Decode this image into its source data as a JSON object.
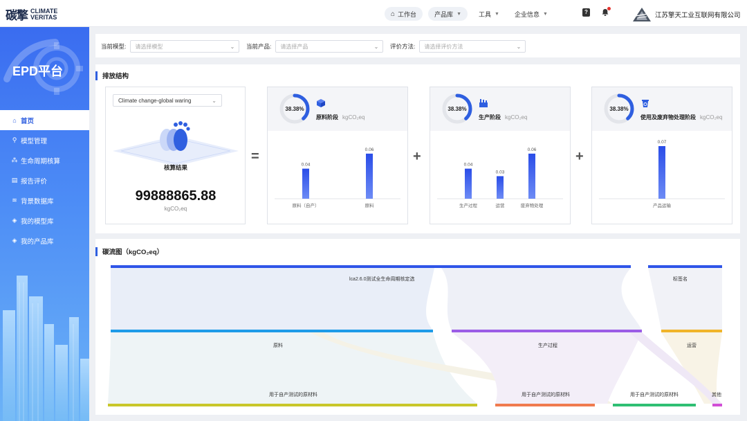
{
  "header": {
    "logo_cn": "碳擎",
    "logo_en_1": "CLIMATE",
    "logo_en_2": "VERITAS",
    "nav": [
      {
        "label": "工作台",
        "icon": "home-icon"
      },
      {
        "label": "产品库",
        "icon": "chevron-down-icon"
      },
      {
        "label": "工具",
        "icon": "chevron-down-icon"
      },
      {
        "label": "企业信息",
        "icon": "chevron-down-icon"
      }
    ],
    "help_glyph": "?",
    "company": "江苏擎天工业互联网有限公司"
  },
  "sidebar": {
    "title": "EPD平台",
    "items": [
      {
        "label": "首页",
        "icon": "home-icon"
      },
      {
        "label": "模型管理",
        "icon": "model-icon"
      },
      {
        "label": "生命周期核算",
        "icon": "lifecycle-icon"
      },
      {
        "label": "报告评价",
        "icon": "report-icon"
      },
      {
        "label": "背景数据库",
        "icon": "database-icon"
      },
      {
        "label": "我的模型库",
        "icon": "cube-icon"
      },
      {
        "label": "我的产品库",
        "icon": "cube-icon"
      }
    ]
  },
  "filters": [
    {
      "label": "当前模型:",
      "placeholder": "请选择模型"
    },
    {
      "label": "当前产品:",
      "placeholder": "请选择产品"
    },
    {
      "label": "评价方法:",
      "placeholder": "请选择评价方法"
    }
  ],
  "emission": {
    "title": "排放结构",
    "method": "Climate change-global waring",
    "result_label": "核算结果",
    "result_value": "99888865.88",
    "result_unit": "kgCO₂eq",
    "op_equal": "=",
    "op_plus": "+",
    "stages": [
      {
        "name": "原料阶段",
        "unit": "kgCO₂eq",
        "percent_text": "38.38%",
        "percent": 38.38,
        "icon": "package-icon",
        "bars": [
          {
            "label": "原料（自产）",
            "value": 0.04,
            "value_text": "0.04"
          },
          {
            "label": "原料",
            "value": 0.06,
            "value_text": "0.06"
          }
        ]
      },
      {
        "name": "生产阶段",
        "unit": "kgCO₂eq",
        "percent_text": "38.38%",
        "percent": 38.38,
        "icon": "factory-icon",
        "bars": [
          {
            "label": "生产过程",
            "value": 0.04,
            "value_text": "0.04"
          },
          {
            "label": "运营",
            "value": 0.03,
            "value_text": "0.03"
          },
          {
            "label": "废弃物处理",
            "value": 0.06,
            "value_text": "0.06"
          }
        ]
      },
      {
        "name": "使用及废弃物处理阶段",
        "unit": "kgCO₂eq",
        "percent_text": "38.38%",
        "percent": 38.38,
        "icon": "recycle-bin-icon",
        "bars": [
          {
            "label": "产品运输",
            "value": 0.07,
            "value_text": "0.07"
          }
        ]
      }
    ]
  },
  "sankey": {
    "title": "碳流图（kgCO₂eq）",
    "top_nodes": [
      {
        "label": "lca2.6.0测试全生命周期核定选",
        "color": "#2f55e8"
      },
      {
        "label": "标签名",
        "color": "#2f55e8"
      }
    ],
    "mid_nodes": [
      {
        "label": "原料",
        "color": "#1e9be8"
      },
      {
        "label": "生产过程",
        "color": "#9b5ce6"
      },
      {
        "label": "运营",
        "color": "#f0b429"
      }
    ],
    "bottom_nodes": [
      {
        "label": "用于自产测试的原材料",
        "color": "#c9c72a"
      },
      {
        "label": "用于自产测试的原材料",
        "color": "#f07b4f"
      },
      {
        "label": "用于自产测试的原材料",
        "color": "#2fbf73"
      },
      {
        "label": "其他",
        "color": "#d14ed6"
      }
    ]
  },
  "colors": {
    "accent": "#2f5fe0",
    "bar_gradient_top": "#2a4de8",
    "bar_gradient_bottom": "#6d8bf5"
  }
}
